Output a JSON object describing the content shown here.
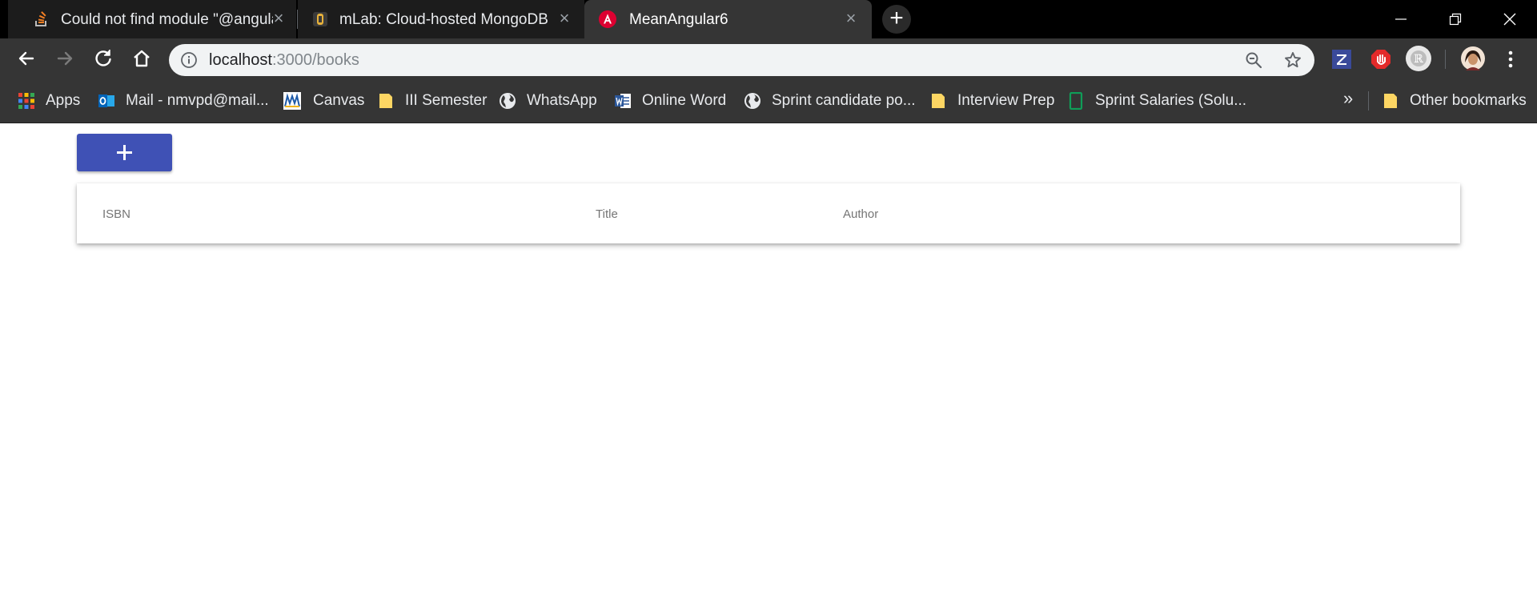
{
  "browser": {
    "tabs": [
      {
        "title": "Could not find module \"@angular",
        "favicon": "stackoverflow-icon",
        "active": false
      },
      {
        "title": "mLab: Cloud-hosted MongoDB",
        "favicon": "mlab-icon",
        "active": false
      },
      {
        "title": "MeanAngular6",
        "favicon": "angular-icon",
        "active": true
      }
    ],
    "address_bar": {
      "host": "localhost",
      "path": ":3000/books"
    },
    "bookmarks": [
      {
        "label": "Apps",
        "icon": "apps-grid-icon"
      },
      {
        "label": "Mail - nmvpd@mail...",
        "icon": "outlook-icon"
      },
      {
        "label": "Canvas",
        "icon": "umkc-icon"
      },
      {
        "label": "III Semester",
        "icon": "folder-icon"
      },
      {
        "label": "WhatsApp",
        "icon": "globe-icon"
      },
      {
        "label": "Online Word",
        "icon": "word-icon"
      },
      {
        "label": "Sprint candidate po...",
        "icon": "globe-icon"
      },
      {
        "label": "Interview Prep",
        "icon": "folder-icon"
      },
      {
        "label": "Sprint Salaries (Solu...",
        "icon": "sheets-icon"
      }
    ],
    "bookmarks_more": "»",
    "other_bookmarks": "Other bookmarks"
  },
  "page": {
    "add_button_icon": "plus-icon",
    "table": {
      "columns": [
        "ISBN",
        "Title",
        "Author"
      ]
    }
  },
  "colors": {
    "accent": "#3f51b5",
    "browser_dark": "#353535"
  }
}
